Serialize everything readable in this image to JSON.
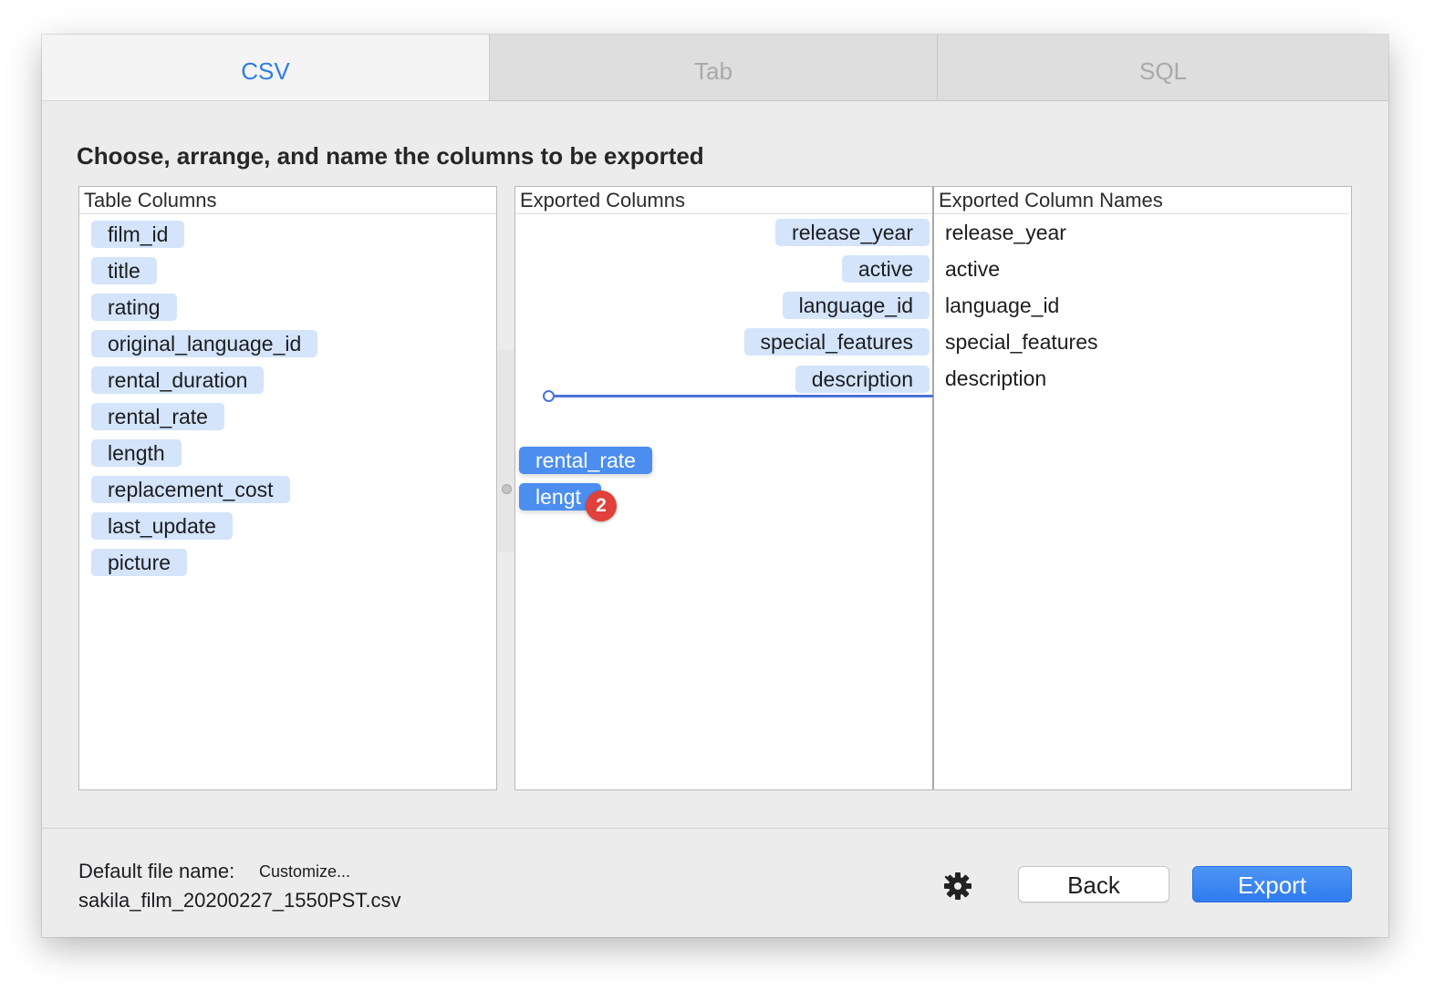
{
  "tabs": [
    {
      "label": "CSV",
      "active": true
    },
    {
      "label": "Tab",
      "active": false
    },
    {
      "label": "SQL",
      "active": false
    }
  ],
  "heading": "Choose, arrange, and name the columns to be exported",
  "table_columns": {
    "header": "Table Columns",
    "items": [
      "film_id",
      "title",
      "rating",
      "original_language_id",
      "rental_duration",
      "rental_rate",
      "length",
      "replacement_cost",
      "last_update",
      "picture"
    ]
  },
  "exported_columns": {
    "header": "Exported Columns",
    "names_header": "Exported Column Names",
    "items": [
      {
        "column": "release_year",
        "name": "release_year"
      },
      {
        "column": "active",
        "name": "active"
      },
      {
        "column": "language_id",
        "name": "language_id"
      },
      {
        "column": "special_features",
        "name": "special_features"
      },
      {
        "column": "description",
        "name": "description"
      }
    ]
  },
  "drag": {
    "items": [
      "rental_rate",
      "lengt"
    ],
    "count": "2"
  },
  "footer": {
    "default_label": "Default file name:",
    "customize_label": "Customize...",
    "file_name": "sakila_film_20200227_1550PST.csv",
    "settings_icon": "gear-icon",
    "back_label": "Back",
    "export_label": "Export"
  },
  "colors": {
    "accent": "#2f7de1",
    "pill_bg": "#d3e4fb",
    "drag_pill_bg": "#4b8ef0",
    "badge": "#e0413c",
    "export_button": "#2f7bef"
  }
}
